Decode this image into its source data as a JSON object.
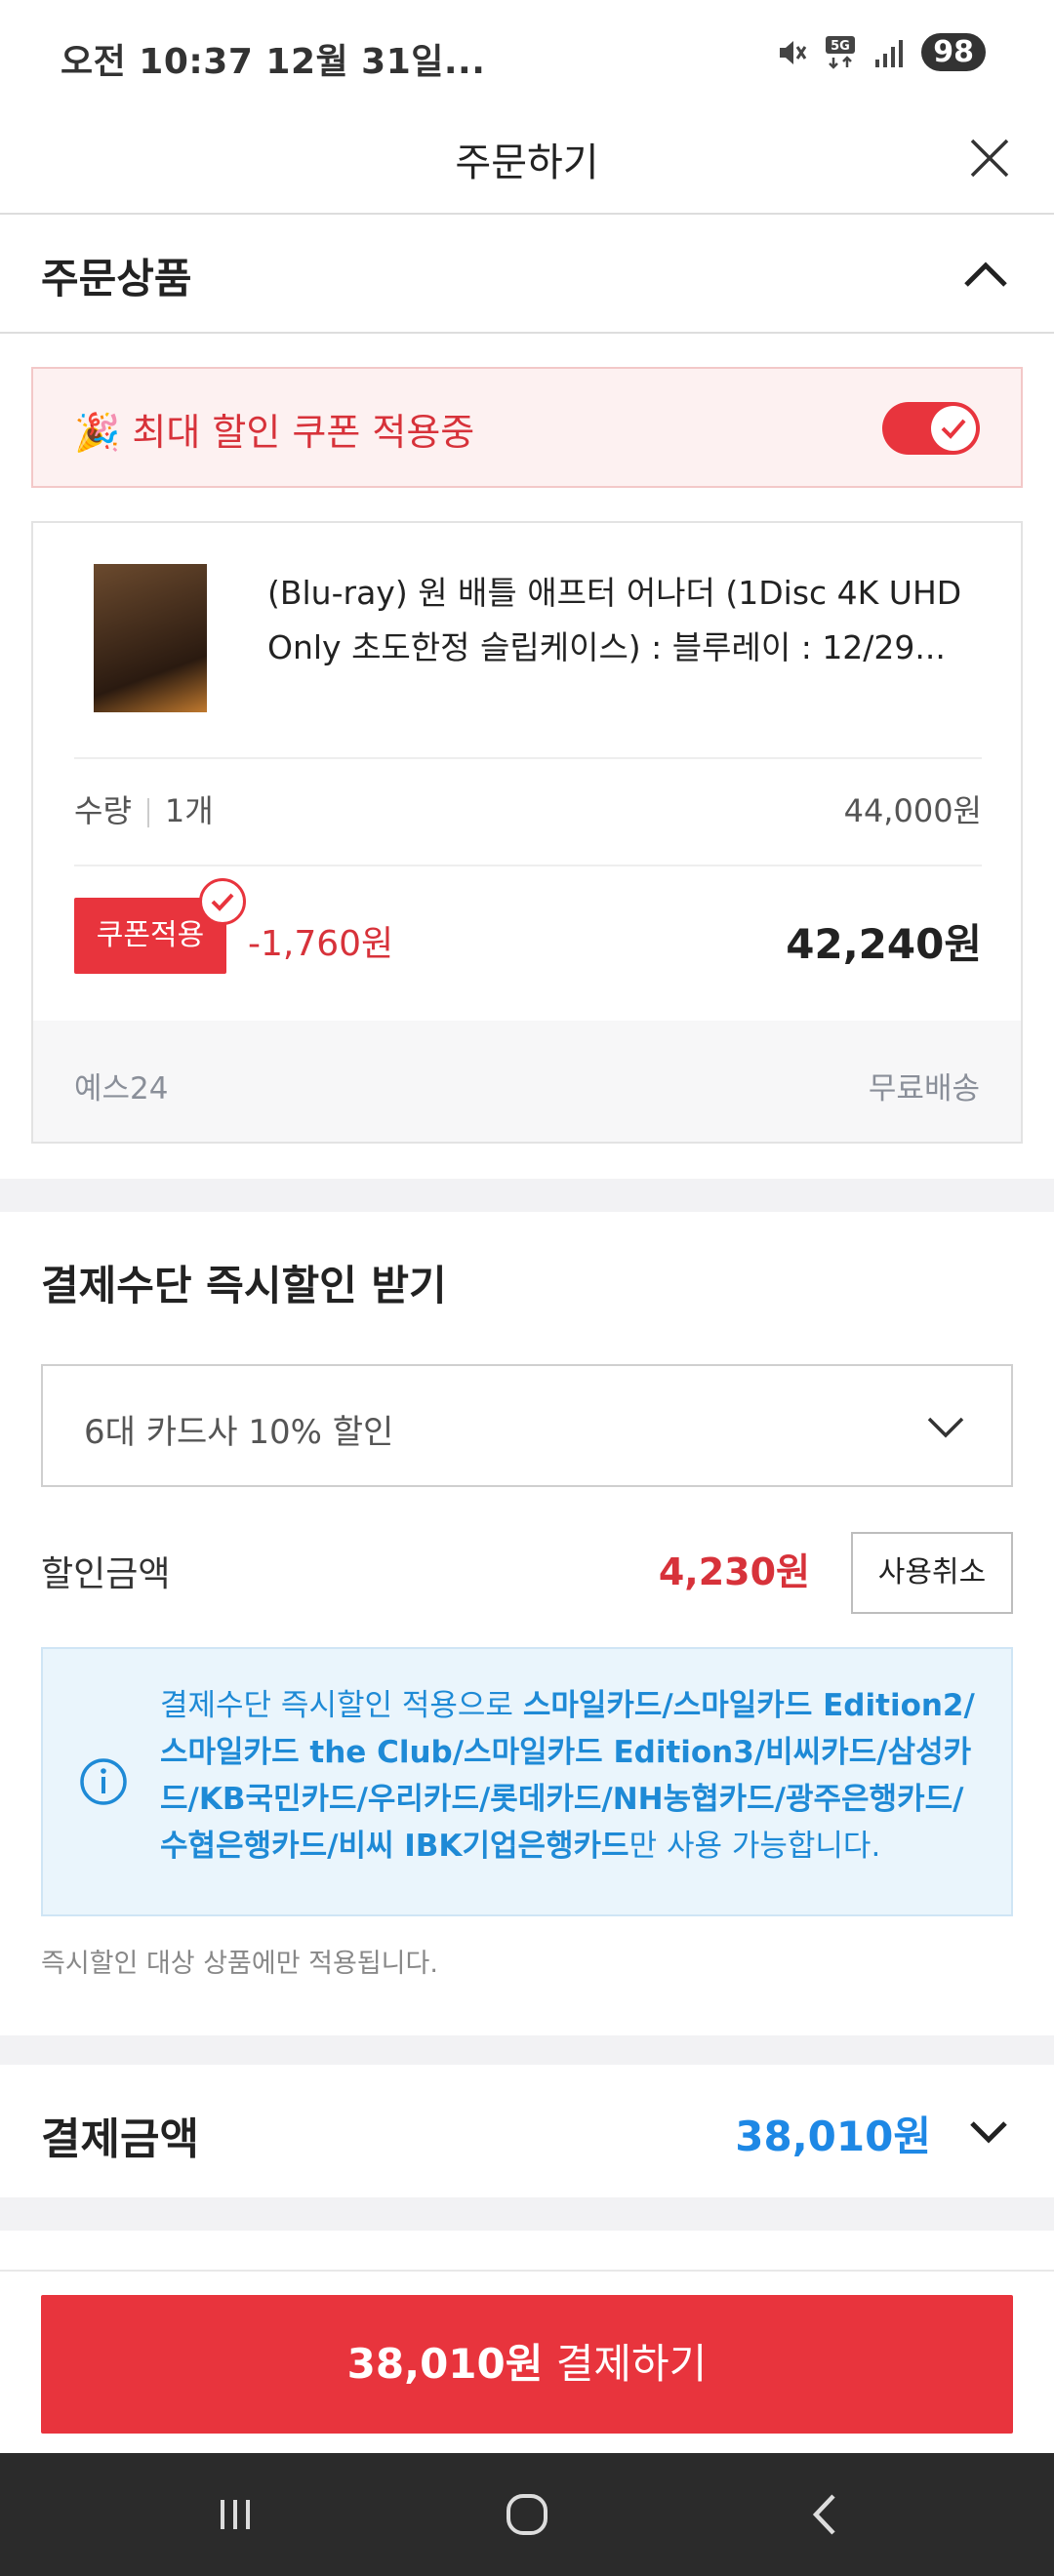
{
  "status_bar": {
    "time": "오전 10:37  12월 31일...",
    "battery": "98",
    "network": "5G"
  },
  "header": {
    "title": "주문하기"
  },
  "order_section": {
    "title": "주문상품"
  },
  "coupon_banner": {
    "text": "🎉 최대 할인 쿠폰 적용중",
    "toggle_on": true
  },
  "product": {
    "name": "(Blu-ray) 원 배틀 애프터 어나더 (1Disc 4K UHD Only 초도한정 슬립케이스) : 블루레이 : 12/29...",
    "qty_label": "수량",
    "qty_value": "1개",
    "price": "44,000원",
    "coupon_button": "쿠폰적용",
    "coupon_discount": "-1,760원",
    "final_price": "42,240원",
    "seller": "예스24",
    "shipping": "무료배송"
  },
  "payment_discount": {
    "title": "결제수단 즉시할인 받기",
    "select_value": "6대 카드사 10% 할인",
    "amount_label": "할인금액",
    "amount": "4,230원",
    "cancel_button": "사용취소",
    "info_prefix": "결제수단 즉시할인 적용으로 ",
    "info_cards": "스마일카드/스마일카드 Edition2/스마일카드 the Club/스마일카드 Edition3/비씨카드/삼성카드/KB국민카드/우리카드/롯데카드/NH농협카드/광주은행카드/수협은행카드/비씨 IBK기업은행카드",
    "info_suffix": "만 사용 가능합니다.",
    "note": "즉시할인 대상 상품에만 적용됩니다."
  },
  "total": {
    "label": "결제금액",
    "amount": "38,010원"
  },
  "pay_button": {
    "amount": "38,010원",
    "label": " 결제하기"
  },
  "colors": {
    "accent_red": "#e8343d",
    "accent_blue": "#1e88e5"
  }
}
